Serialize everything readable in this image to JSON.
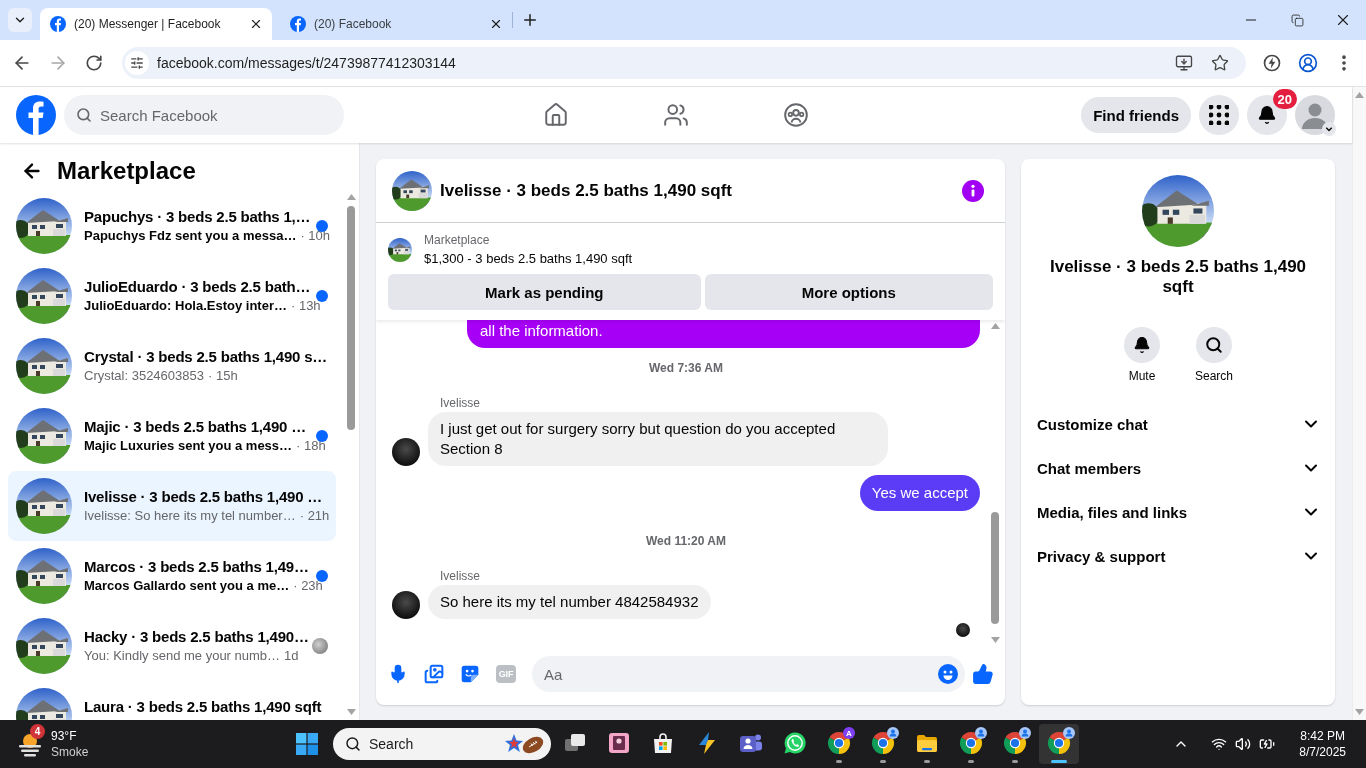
{
  "browser": {
    "tabs": [
      {
        "title": "(20) Messenger | Facebook",
        "selected": true
      },
      {
        "title": "(20) Facebook",
        "selected": false
      }
    ],
    "url": "facebook.com/messages/t/24739877412303144",
    "forward_disabled": true
  },
  "facebook_nav": {
    "search_placeholder": "Search Facebook",
    "find_friends": "Find friends",
    "notification_count": "20"
  },
  "sidebar": {
    "title": "Marketplace",
    "conversations": [
      {
        "title": "Papuchys · 3 beds 2.5 baths 1,…",
        "preview": "Papuchys Fdz sent you a messa…",
        "time": "· 10h",
        "unread": true,
        "seen": false,
        "selected": false
      },
      {
        "title": "JulioEduardo · 3 beds 2.5 bath…",
        "preview": "JulioEduardo: Hola.Estoy inter…",
        "time": "· 13h",
        "unread": true,
        "seen": false,
        "selected": false
      },
      {
        "title": "Crystal · 3 beds 2.5 baths 1,490 s…",
        "preview": "Crystal: 3524603853",
        "time": "· 15h",
        "unread": false,
        "seen": false,
        "selected": false
      },
      {
        "title": "Majic · 3 beds 2.5 baths 1,490 …",
        "preview": "Majic Luxuries sent you a mess…",
        "time": "· 18h",
        "unread": true,
        "seen": false,
        "selected": false
      },
      {
        "title": "Ivelisse · 3 beds 2.5 baths 1,490 …",
        "preview": "Ivelisse: So here its my tel number…",
        "time": "· 21h",
        "unread": false,
        "seen": false,
        "selected": true
      },
      {
        "title": "Marcos · 3 beds 2.5 baths 1,49…",
        "preview": "Marcos Gallardo sent you a me…",
        "time": "· 23h",
        "unread": true,
        "seen": false,
        "selected": false
      },
      {
        "title": "Hacky · 3 beds 2.5 baths 1,490…",
        "preview": "You: Kindly send me your numb…",
        "time": "1d",
        "unread": false,
        "seen": true,
        "selected": false
      },
      {
        "title": "Laura · 3 beds 2.5 baths 1,490 sqft",
        "selected": false
      }
    ]
  },
  "chat": {
    "title": "Ivelisse · 3 beds 2.5 baths 1,490 sqft",
    "listing": {
      "label": "Marketplace",
      "summary": "$1,300 - 3 beds 2.5 baths 1,490 sqft",
      "buttons": [
        "Mark as pending",
        "More options"
      ]
    },
    "messages": [
      {
        "kind": "outgoing",
        "text": "all the information.",
        "clipped": true
      },
      {
        "kind": "timestamp",
        "text": "Wed 7:36 AM"
      },
      {
        "kind": "incoming",
        "sender": "Ivelisse",
        "text": "I just get out for surgery sorry but question do you accepted Section 8",
        "clipped": false
      },
      {
        "kind": "outgoing",
        "text": "Yes we accept",
        "clipped": false
      },
      {
        "kind": "timestamp",
        "text": "Wed 11:20 AM"
      },
      {
        "kind": "incoming",
        "sender": "Ivelisse",
        "text": "So here its my tel number 4842584932",
        "clipped": false
      },
      {
        "kind": "seen"
      }
    ],
    "composer": {
      "gif_label": "GIF",
      "placeholder": "Aa"
    }
  },
  "details": {
    "title": "Ivelisse · 3 beds 2.5 baths 1,490 sqft",
    "actions": [
      {
        "kind": "mute",
        "label": "Mute"
      },
      {
        "kind": "search",
        "label": "Search"
      }
    ],
    "sections": [
      {
        "label": "Customize chat",
        "expanded": false
      },
      {
        "label": "Chat members",
        "expanded": false
      },
      {
        "label": "Media, files and links",
        "expanded": false
      },
      {
        "label": "Privacy & support",
        "expanded": false
      }
    ]
  },
  "taskbar": {
    "weather": {
      "badge": "4",
      "temperature": "93°F",
      "condition": "Smoke"
    },
    "search_placeholder": "Search",
    "apps": [
      {
        "kind": "task-view",
        "running": false,
        "selected": false
      },
      {
        "kind": "photo-app",
        "running": false,
        "selected": false
      },
      {
        "kind": "store",
        "running": false,
        "selected": false
      },
      {
        "kind": "automate",
        "running": false,
        "selected": false
      },
      {
        "kind": "teams",
        "running": false,
        "selected": false
      },
      {
        "kind": "whatsapp",
        "running": false,
        "selected": false
      },
      {
        "kind": "chrome",
        "badge": "A",
        "running": true,
        "selected": false
      },
      {
        "kind": "chrome",
        "running": true,
        "selected": false
      },
      {
        "kind": "files",
        "running": true,
        "selected": false
      },
      {
        "kind": "chrome",
        "running": true,
        "selected": false
      },
      {
        "kind": "chrome",
        "running": true,
        "selected": false
      },
      {
        "kind": "chrome",
        "running": true,
        "selected": true
      }
    ],
    "clock": {
      "time": "8:42 PM",
      "date": "8/7/2025"
    }
  }
}
